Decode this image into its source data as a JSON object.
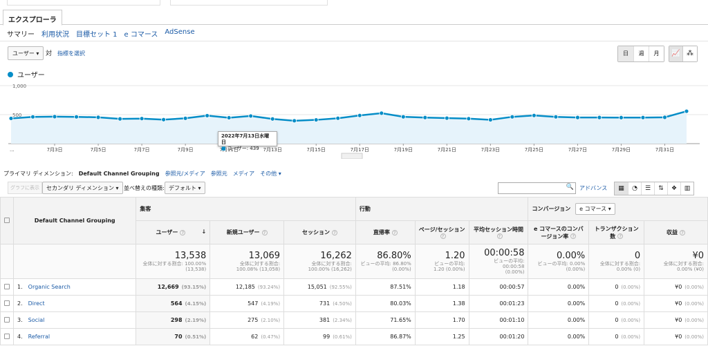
{
  "tabs": {
    "active": "エクスプローラ"
  },
  "subtabs": [
    "サマリー",
    "利用状況",
    "目標セット 1",
    "e コマース",
    "AdSense"
  ],
  "controls": {
    "metric": "ユーザー",
    "vs": "対",
    "pick_metric": "指標を選択",
    "periods": [
      "日",
      "週",
      "月"
    ],
    "legend": "ユーザー"
  },
  "chart_data": {
    "type": "line",
    "series": [
      {
        "name": "ユーザー",
        "values": [
          435,
          462,
          466,
          462,
          454,
          427,
          432,
          414,
          437,
          483,
          447,
          477,
          426,
          395,
          410,
          438,
          486,
          525,
          463,
          450,
          440,
          431,
          411,
          462,
          486,
          462,
          451,
          451,
          449,
          450,
          454,
          559
        ]
      }
    ],
    "x_ticks": [
      "7月3日",
      "7月5日",
      "7月7日",
      "7月9日",
      "7月11日",
      "7月13日",
      "7月15日",
      "7月17日",
      "7月19日",
      "7月21日",
      "7月23日",
      "7月25日",
      "7月27日",
      "7月29日",
      "7月31日"
    ],
    "y_ticks": [
      "1,000",
      "500"
    ],
    "ylim": [
      0,
      1000
    ],
    "color": "#058dc7",
    "tooltip": {
      "date": "2022年7月13日水曜日",
      "label": "ユーザー: 439"
    }
  },
  "dimension": {
    "label": "プライマリ ディメンション:",
    "current": "Default Channel Grouping",
    "others": [
      "参照元/メディア",
      "参照元",
      "メディア",
      "その他"
    ]
  },
  "toolbar": {
    "graph_button": "グラフに表示",
    "secondary": "セカンダリ ディメンション",
    "sort_label": "並べ替えの種類:",
    "sort_value": "デフォルト",
    "advanced": "アドバンス"
  },
  "table": {
    "dim_header": "Default Channel Grouping",
    "groups": [
      "集客",
      "行動",
      "コンバージョン"
    ],
    "conversion_select": "e コマース",
    "columns": [
      "ユーザー",
      "新規ユーザー",
      "セッション",
      "直帰率",
      "ページ/セッション",
      "平均セッション時間",
      "e コマースのコンバージョン率",
      "トランザクション数",
      "収益"
    ],
    "totals": [
      {
        "value": "13,538",
        "sub1": "全体に対する割合: 100.00%",
        "sub2": "(13,538)"
      },
      {
        "value": "13,069",
        "sub1": "全体に対する割合:",
        "sub2": "100.08% (13,058)"
      },
      {
        "value": "16,262",
        "sub1": "全体に対する割合:",
        "sub2": "100.00% (16,262)"
      },
      {
        "value": "86.80%",
        "sub1": "ビューの平均: 86.80%",
        "sub2": "(0.00%)"
      },
      {
        "value": "1.20",
        "sub1": "ビューの平均:",
        "sub2": "1.20 (0.00%)"
      },
      {
        "value": "00:00:58",
        "sub1": "ビューの平均: 00:00:58",
        "sub2": "(0.00%)"
      },
      {
        "value": "0.00%",
        "sub1": "ビューの平均: 0.00%",
        "sub2": "(0.00%)"
      },
      {
        "value": "0",
        "sub1": "全体に対する割合:",
        "sub2": "0.00% (0)"
      },
      {
        "value": "¥0",
        "sub1": "全体に対する割合:",
        "sub2": "0.00% (¥0)"
      }
    ],
    "rows": [
      {
        "idx": "1.",
        "name": "Organic Search",
        "users": "12,669",
        "users_pct": "(93.15%)",
        "new": "12,185",
        "new_pct": "(93.24%)",
        "sessions": "15,051",
        "sessions_pct": "(92.55%)",
        "bounce": "87.51%",
        "pps": "1.18",
        "avg": "00:00:57",
        "conv": "0.00%",
        "tx": "0",
        "tx_pct": "(0.00%)",
        "rev": "¥0",
        "rev_pct": "(0.00%)"
      },
      {
        "idx": "2.",
        "name": "Direct",
        "users": "564",
        "users_pct": "(4.15%)",
        "new": "547",
        "new_pct": "(4.19%)",
        "sessions": "731",
        "sessions_pct": "(4.50%)",
        "bounce": "80.03%",
        "pps": "1.38",
        "avg": "00:01:23",
        "conv": "0.00%",
        "tx": "0",
        "tx_pct": "(0.00%)",
        "rev": "¥0",
        "rev_pct": "(0.00%)"
      },
      {
        "idx": "3.",
        "name": "Social",
        "users": "298",
        "users_pct": "(2.19%)",
        "new": "275",
        "new_pct": "(2.10%)",
        "sessions": "381",
        "sessions_pct": "(2.34%)",
        "bounce": "71.65%",
        "pps": "1.70",
        "avg": "00:01:10",
        "conv": "0.00%",
        "tx": "0",
        "tx_pct": "(0.00%)",
        "rev": "¥0",
        "rev_pct": "(0.00%)"
      },
      {
        "idx": "4.",
        "name": "Referral",
        "users": "70",
        "users_pct": "(0.51%)",
        "new": "62",
        "new_pct": "(0.47%)",
        "sessions": "99",
        "sessions_pct": "(0.61%)",
        "bounce": "86.87%",
        "pps": "1.25",
        "avg": "00:01:20",
        "conv": "0.00%",
        "tx": "0",
        "tx_pct": "(0.00%)",
        "rev": "¥0",
        "rev_pct": "(0.00%)"
      }
    ]
  }
}
